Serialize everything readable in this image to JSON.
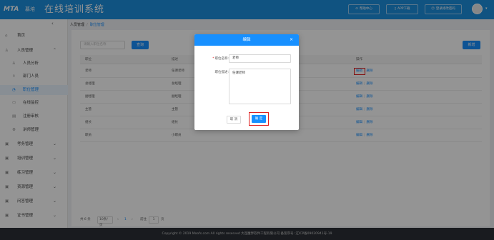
{
  "header": {
    "logo_text": "MTA",
    "logo_sub": "慕培",
    "app_title": "在线培训系统",
    "buttons": [
      {
        "icon": "help-icon",
        "label": "帮助中心"
      },
      {
        "icon": "phone-icon",
        "label": "APP下载"
      },
      {
        "icon": "user-icon",
        "label": "登录修改密码"
      }
    ]
  },
  "sidebar": {
    "items": [
      {
        "icon": "home-icon",
        "label": "首页"
      },
      {
        "icon": "users-icon",
        "label": "人员管理",
        "chevron": "⌃"
      },
      {
        "icon": "chart-icon",
        "label": "人员分析"
      },
      {
        "icon": "dept-icon",
        "label": "部门人员"
      },
      {
        "icon": "position-icon",
        "label": "职位管理"
      },
      {
        "icon": "monitor-icon",
        "label": "在线监控"
      },
      {
        "icon": "audit-icon",
        "label": "注册审核"
      },
      {
        "icon": "lecturer-icon",
        "label": "讲师管理"
      },
      {
        "icon": "exam-icon",
        "label": "考务管理",
        "chevron": "⌄"
      },
      {
        "icon": "train-icon",
        "label": "培训管理",
        "chevron": "⌄"
      },
      {
        "icon": "practice-icon",
        "label": "练习管理",
        "chevron": "⌄"
      },
      {
        "icon": "resource-icon",
        "label": "资源管理",
        "chevron": "⌄"
      },
      {
        "icon": "qa-icon",
        "label": "问答管理",
        "chevron": "⌄"
      },
      {
        "icon": "cert-icon",
        "label": "证书管理",
        "chevron": "⌄"
      }
    ]
  },
  "breadcrumb": {
    "root": "人员管理",
    "sep": "/",
    "current": "职位管理"
  },
  "toolbar": {
    "search_placeholder": "请输入职位名称",
    "search_label": "查询",
    "add_label": "新增"
  },
  "table": {
    "headers": [
      "职位",
      "描述",
      "操作"
    ],
    "rows": [
      {
        "position": "老师",
        "desc": "任课老师"
      },
      {
        "position": "总经理",
        "desc": "总经理"
      },
      {
        "position": "副经理",
        "desc": "副经理"
      },
      {
        "position": "主管",
        "desc": "主管"
      },
      {
        "position": "组长",
        "desc": "组长"
      },
      {
        "position": "职员",
        "desc": "小职员"
      }
    ],
    "edit_label": "编辑",
    "op_sep": "|",
    "delete_label": "删除"
  },
  "pager": {
    "total_label": "共 6 条",
    "page_size": "10条/页",
    "prev": "‹",
    "page": "1",
    "next": "›",
    "goto_label": "前往",
    "goto_value": "1",
    "page_suffix": "页"
  },
  "footer": {
    "text": "Copyright © 2019 Moofs.com All rights reserved 大连魔界软件工程有限公司 备案序号: 辽ICP备09020941号-19"
  },
  "dialog": {
    "title": "编辑",
    "close": "×",
    "name_req": "*",
    "name_label": "职位名称:",
    "name_value": "老师",
    "desc_label": "职位描述:",
    "desc_value": "任课老师",
    "cancel_label": "取 消",
    "ok_label": "确 定"
  }
}
